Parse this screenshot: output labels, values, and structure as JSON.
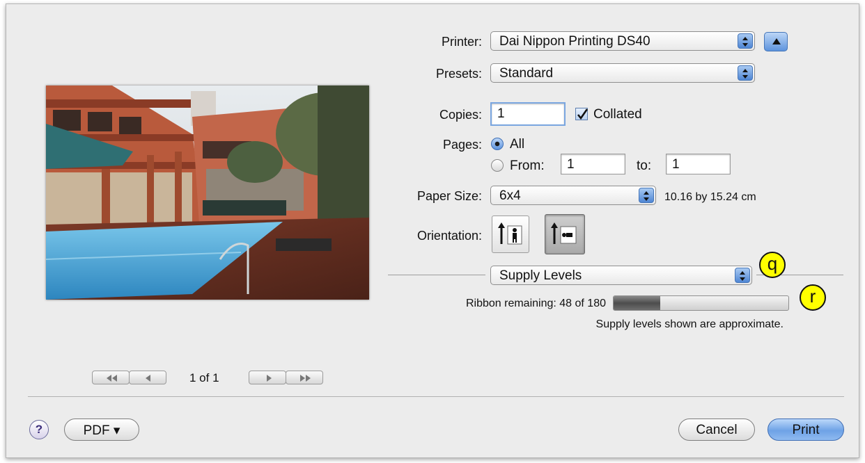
{
  "printer": {
    "label": "Printer:",
    "value": "Dai Nippon Printing  DS40"
  },
  "presets": {
    "label": "Presets:",
    "value": "Standard"
  },
  "copies": {
    "label": "Copies:",
    "value": "1",
    "collated_label": "Collated",
    "collated_checked": true
  },
  "pages": {
    "label": "Pages:",
    "all_label": "All",
    "from_label": "From:",
    "from_value": "1",
    "to_label": "to:",
    "to_value": "1",
    "selected": "All"
  },
  "paper_size": {
    "label": "Paper Size:",
    "value": "6x4",
    "dimensions": "10.16 by 15.24 cm"
  },
  "orientation": {
    "label": "Orientation:",
    "selected": "landscape"
  },
  "panel_select": {
    "value": "Supply Levels"
  },
  "supply": {
    "ribbon_label": "Ribbon remaining: 48 of 180",
    "remaining": 48,
    "total": 180,
    "note": "Supply levels shown are approximate."
  },
  "callouts": {
    "q": "q",
    "r": "r"
  },
  "preview_nav": {
    "page_indicator": "1 of 1"
  },
  "footer": {
    "help_label": "?",
    "pdf_label": "PDF ▾",
    "cancel_label": "Cancel",
    "print_label": "Print"
  },
  "colors": {
    "accent": "#5d93dd",
    "callout": "#ffff00",
    "dialog_bg": "#ececec"
  }
}
